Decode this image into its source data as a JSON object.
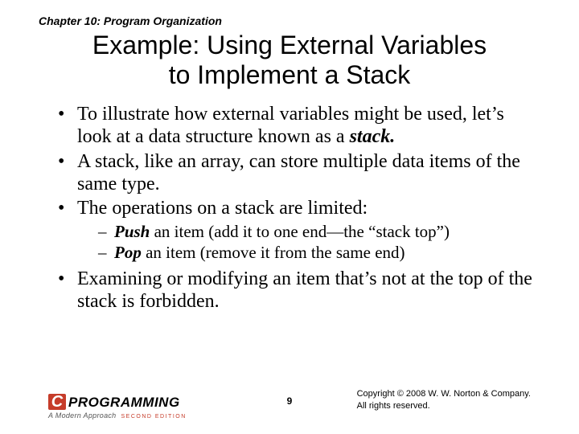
{
  "chapter": "Chapter 10: Program Organization",
  "title_l1": "Example: Using External Variables",
  "title_l2": "to Implement a Stack",
  "bullets": {
    "b1a": "To illustrate how external variables might be used, let’s look at a data structure known as a ",
    "b1_em": "stack.",
    "b2": "A stack, like an array, can store multiple data items of the same type.",
    "b3": "The operations on a stack are limited:",
    "s1_em": "Push",
    "s1_rest": " an item (add it to one end—the “stack top”)",
    "s2_em": "Pop",
    "s2_rest": " an item (remove it from the same end)",
    "b4": "Examining or modifying an item that’s not at the top of the stack is forbidden."
  },
  "footer": {
    "logo_c": "C",
    "logo_text": "PROGRAMMING",
    "logo_sub": "A Modern Approach",
    "logo_ed": "SECOND EDITION",
    "page": "9",
    "copy_l1": "Copyright © 2008 W. W. Norton & Company.",
    "copy_l2": "All rights reserved."
  }
}
